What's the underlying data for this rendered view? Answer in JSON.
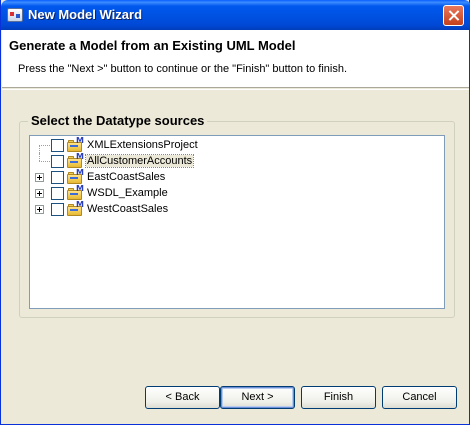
{
  "window": {
    "title": "New Model Wizard"
  },
  "header": {
    "title": "Generate a Model from an Existing UML Model",
    "description": "Press the \"Next >\" button to continue or the \"Finish\" button to finish."
  },
  "group": {
    "legend": "Select the Datatype sources"
  },
  "tree": {
    "items": [
      {
        "label": "XMLExtensionsProject",
        "expandable": false,
        "checked": false,
        "selected": false
      },
      {
        "label": "AllCustomerAccounts",
        "expandable": false,
        "checked": false,
        "selected": true
      },
      {
        "label": "EastCoastSales",
        "expandable": true,
        "checked": false,
        "selected": false
      },
      {
        "label": "WSDL_Example",
        "expandable": true,
        "checked": false,
        "selected": false
      },
      {
        "label": "WestCoastSales",
        "expandable": true,
        "checked": false,
        "selected": false
      }
    ]
  },
  "buttons": {
    "back": "< Back",
    "next": "Next >",
    "finish": "Finish",
    "cancel": "Cancel"
  },
  "icons": {
    "project_badge": "M"
  },
  "colors": {
    "titlebar": "#0054e3",
    "dialog_bg": "#ece9d8",
    "tree_border": "#7f9db9"
  }
}
